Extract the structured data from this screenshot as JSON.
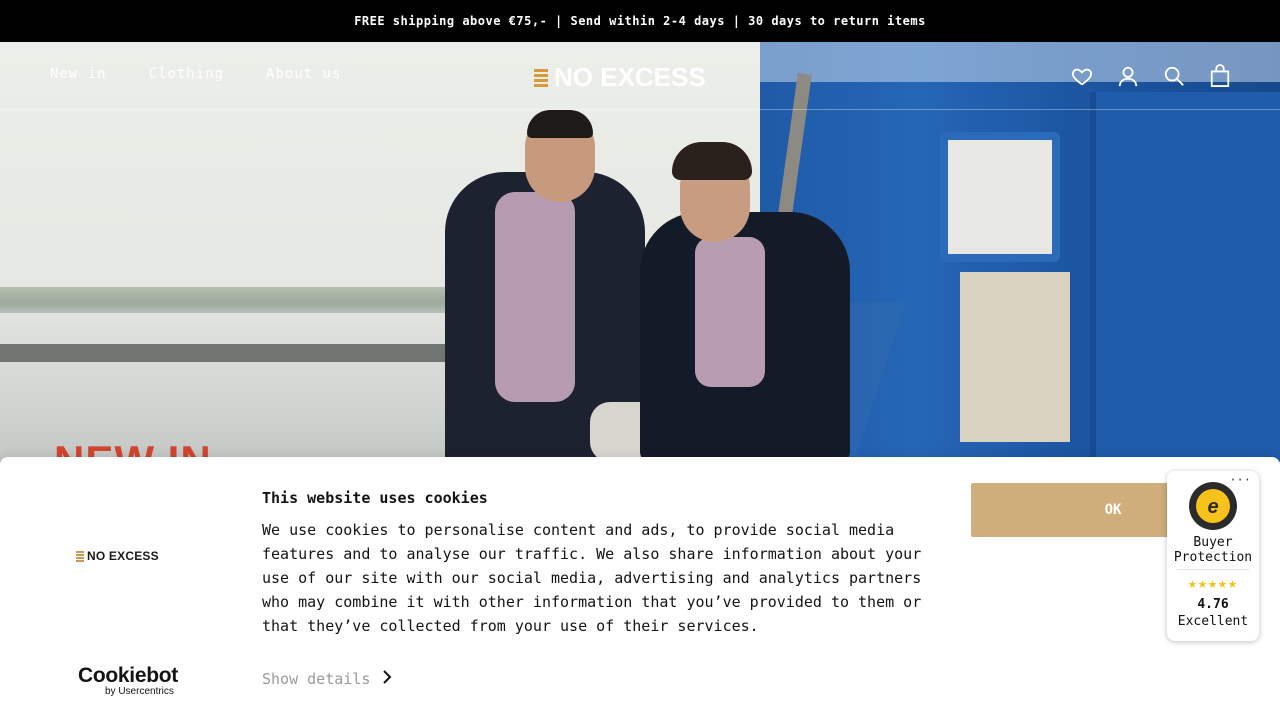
{
  "announcement": "FREE shipping above €75,- | Send within 2-4 days | 30 days to return items",
  "header": {
    "nav": [
      {
        "label": "New in"
      },
      {
        "label": "Clothing"
      },
      {
        "label": "About us"
      }
    ],
    "logo": "NO EXCESS",
    "icons": [
      "heart-icon",
      "account-icon",
      "search-icon",
      "bag-icon"
    ]
  },
  "hero": {
    "title": "NEW IN"
  },
  "cookie_banner": {
    "logo": "NO EXCESS",
    "title": "This website uses cookies",
    "body": "We use cookies to personalise content and ads, to provide social media features and to analyse our traffic. We also share information about your use of our site with our social media, advertising and analytics partners who may combine it with other information that you’ve provided to them or that they’ve collected from your use of their services.",
    "details_label": "Show details",
    "ok_label": "OK",
    "brand_main": "Cookiebot",
    "brand_sub": "by Usercentrics"
  },
  "trust_badge": {
    "line1": "Buyer",
    "line2": "Protection",
    "stars": "★★★★★",
    "rating": "4.76",
    "verdict": "Excellent",
    "menu": "···"
  },
  "colors": {
    "accent": "#cfae7b",
    "hero_title": "#d2452f",
    "star": "#f5c116"
  }
}
